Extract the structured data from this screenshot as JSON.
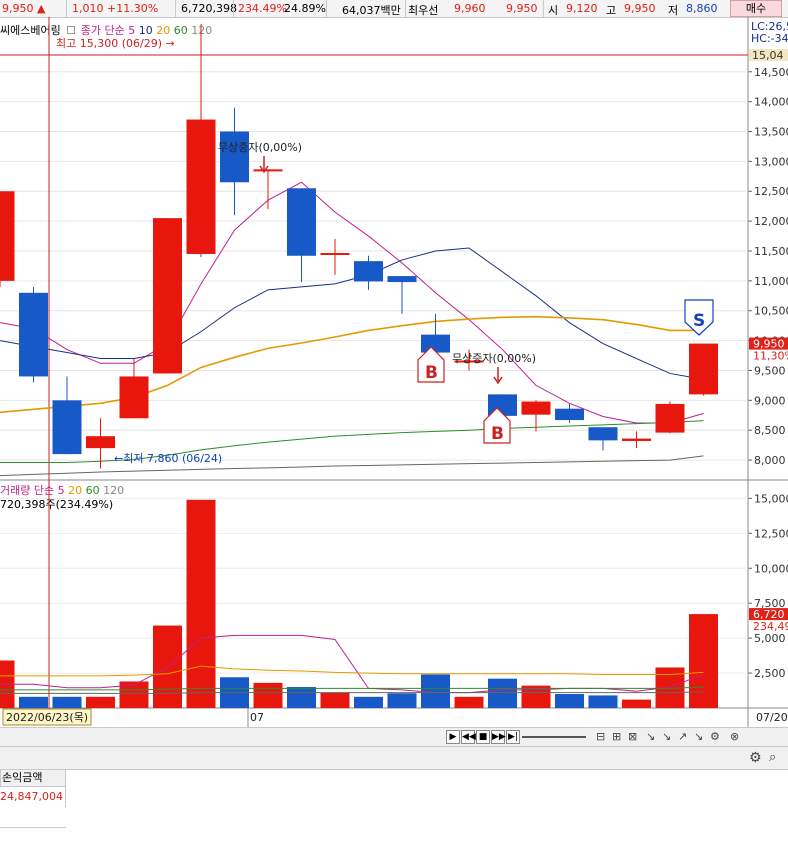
{
  "quote_bar": {
    "price": "9,950 ▲",
    "change": "1,010 +11.30%",
    "volume": "6,720,398",
    "vol_ratio": "234.49%",
    "turnover_pct": "24.89%",
    "amount": "64,037백만",
    "best_bid_label": "최우선",
    "best_bid_1": "9,960",
    "best_bid_2": "9,950",
    "open_label": "시",
    "open": "9,120",
    "high_label": "고",
    "high": "9,950",
    "low_label": "저",
    "low": "8,860",
    "buy_button": "매수"
  },
  "price_legend": {
    "stock": "씨에스베어링",
    "ma_label": "종가 단순",
    "periods": [
      "5",
      "10",
      "20",
      "60",
      "120"
    ],
    "colors": [
      "#c0208f",
      "#1a2e88",
      "#e39a00",
      "#2e8b2e",
      "#666666"
    ]
  },
  "right_top_labels": {
    "lc": "LC:26,5",
    "hc": "HC:-34"
  },
  "volume_legend": {
    "label": "거래량",
    "ma_label": "단순",
    "periods": [
      "5",
      "20",
      "60",
      "120"
    ],
    "info": "720,398주(234.49%)"
  },
  "chart_data": {
    "type": "candlestick",
    "price_axis": {
      "ylim": [
        7700,
        15400
      ],
      "ticks": [
        8000,
        8500,
        9000,
        9500,
        10000,
        10500,
        11000,
        11500,
        12000,
        12500,
        13000,
        13500,
        14000,
        14500
      ],
      "tick_labels": [
        "8,000",
        "8,500",
        "9,000",
        "9,500",
        "10,000",
        "10,500",
        "11,000",
        "11,500",
        "12,000",
        "12,500",
        "13,000",
        "13,500",
        "14,000",
        "14,500"
      ],
      "top_label": "15,04",
      "current_label": "9,950",
      "current_pct_label": "11,30%",
      "current": 9950
    },
    "candles": [
      {
        "o": 11000,
        "h": 12500,
        "l": 10900,
        "c": 12500
      },
      {
        "o": 10800,
        "h": 10900,
        "l": 9300,
        "c": 9400
      },
      {
        "o": 9000,
        "h": 9400,
        "l": 8100,
        "c": 8100
      },
      {
        "o": 8200,
        "h": 8700,
        "l": 7860,
        "c": 8400
      },
      {
        "o": 8700,
        "h": 9700,
        "l": 8700,
        "c": 9400
      },
      {
        "o": 9450,
        "h": 12050,
        "l": 9450,
        "c": 12050
      },
      {
        "o": 11450,
        "h": 15300,
        "l": 11400,
        "c": 13700
      },
      {
        "o": 13500,
        "h": 13900,
        "l": 12100,
        "c": 12650
      },
      {
        "o": 12850,
        "h": 12850,
        "l": 12200,
        "c": 12850
      },
      {
        "o": 12550,
        "h": 12550,
        "l": 10980,
        "c": 11420
      },
      {
        "o": 11450,
        "h": 11700,
        "l": 11100,
        "c": 11450
      },
      {
        "o": 11330,
        "h": 11420,
        "l": 10850,
        "c": 10990
      },
      {
        "o": 11080,
        "h": 11080,
        "l": 10450,
        "c": 10980
      },
      {
        "o": 10100,
        "h": 10450,
        "l": 9750,
        "c": 9800
      },
      {
        "o": 9650,
        "h": 9850,
        "l": 9500,
        "c": 9650
      },
      {
        "o": 9100,
        "h": 9100,
        "l": 8720,
        "c": 8740
      },
      {
        "o": 8760,
        "h": 9000,
        "l": 8480,
        "c": 8980
      },
      {
        "o": 8860,
        "h": 8940,
        "l": 8620,
        "c": 8670
      },
      {
        "o": 8550,
        "h": 8550,
        "l": 8160,
        "c": 8330
      },
      {
        "o": 8320,
        "h": 8480,
        "l": 8200,
        "c": 8360
      },
      {
        "o": 8460,
        "h": 8980,
        "l": 8450,
        "c": 8940
      },
      {
        "o": 9100,
        "h": 9950,
        "l": 9080,
        "c": 9950
      }
    ],
    "ma_series": [
      {
        "period": "5",
        "color": "#c0208f",
        "values": [
          10300,
          10200,
          9850,
          9620,
          9620,
          9950,
          10950,
          11850,
          12350,
          12650,
          12150,
          11750,
          11300,
          10800,
          10350,
          9850,
          9250,
          8950,
          8730,
          8620,
          8620,
          8780
        ]
      },
      {
        "period": "10",
        "color": "#1a2e88",
        "values": [
          10000,
          9900,
          9800,
          9700,
          9700,
          9800,
          10150,
          10550,
          10850,
          10900,
          10950,
          11100,
          11350,
          11500,
          11550,
          11150,
          10750,
          10300,
          9950,
          9700,
          9450,
          9350
        ]
      },
      {
        "period": "20",
        "color": "#e39a00",
        "values": [
          8800,
          8850,
          8900,
          8950,
          9050,
          9250,
          9550,
          9720,
          9870,
          9960,
          10060,
          10170,
          10250,
          10320,
          10360,
          10390,
          10400,
          10380,
          10350,
          10270,
          10170,
          10170
        ]
      },
      {
        "period": "60",
        "color": "#2e8b2e",
        "values": [
          7960,
          7960,
          7960,
          7980,
          8010,
          8080,
          8170,
          8240,
          8300,
          8350,
          8400,
          8430,
          8460,
          8480,
          8500,
          8530,
          8550,
          8570,
          8590,
          8610,
          8630,
          8660
        ]
      },
      {
        "period": "120",
        "color": "#666666",
        "values": [
          7740,
          7760,
          7780,
          7800,
          7815,
          7830,
          7845,
          7860,
          7870,
          7885,
          7900,
          7910,
          7920,
          7930,
          7940,
          7950,
          7960,
          7970,
          7980,
          7990,
          8000,
          8070
        ]
      }
    ],
    "annotations": {
      "high_marker": "최고 15,300 (06/29) →",
      "low_marker": "←최저 7,860 (06/24)",
      "event_1": "무상증자(0,00%)",
      "event_2": "무상증자(0,00%)",
      "buy_signal": "B",
      "sell_signal": "S"
    },
    "volume": {
      "ylim": [
        0,
        15600
      ],
      "ticks": [
        2500,
        5000,
        7500,
        10000,
        12500,
        15000
      ],
      "tick_labels": [
        "2,500",
        "5,000",
        "7,500",
        "10,000",
        "12,500",
        "15,000"
      ],
      "current_label": "6,720",
      "current_pct_label": "234,49",
      "bars": [
        3400,
        800,
        800,
        800,
        1900,
        5900,
        14900,
        2200,
        1800,
        1500,
        1100,
        800,
        1050,
        2400,
        800,
        2100,
        1600,
        1000,
        900,
        600,
        2900,
        6720
      ],
      "ma5": [
        1700,
        1700,
        1450,
        1450,
        1650,
        2900,
        5000,
        5200,
        5200,
        5200,
        4900,
        1400,
        1300,
        1100,
        1100,
        1300,
        1300,
        1400,
        1400,
        1200,
        1500,
        2400
      ],
      "ma20": [
        2300,
        2300,
        2300,
        2300,
        2350,
        2450,
        3000,
        2800,
        2700,
        2650,
        2550,
        2500,
        2450,
        2450,
        2450,
        2450,
        2450,
        2450,
        2400,
        2400,
        2400,
        2550
      ],
      "ma60": [
        1300,
        1300,
        1300,
        1300,
        1300,
        1350,
        1400,
        1400,
        1400,
        1400,
        1400,
        1400,
        1400,
        1400,
        1400,
        1400,
        1400,
        1400,
        1400,
        1400,
        1400,
        1500
      ],
      "ma120": [
        1050,
        1050,
        1050,
        1050,
        1050,
        1050,
        1100,
        1100,
        1100,
        1100,
        1100,
        1100,
        1100,
        1100,
        1100,
        1100,
        1100,
        1100,
        1100,
        1100,
        1100,
        1150
      ]
    },
    "x_axis": {
      "date_label": "2022/06/23(목)",
      "month_label": "07",
      "right_label": "07/20"
    }
  },
  "table": {
    "header": "손익금액",
    "value": "24,847,004"
  }
}
